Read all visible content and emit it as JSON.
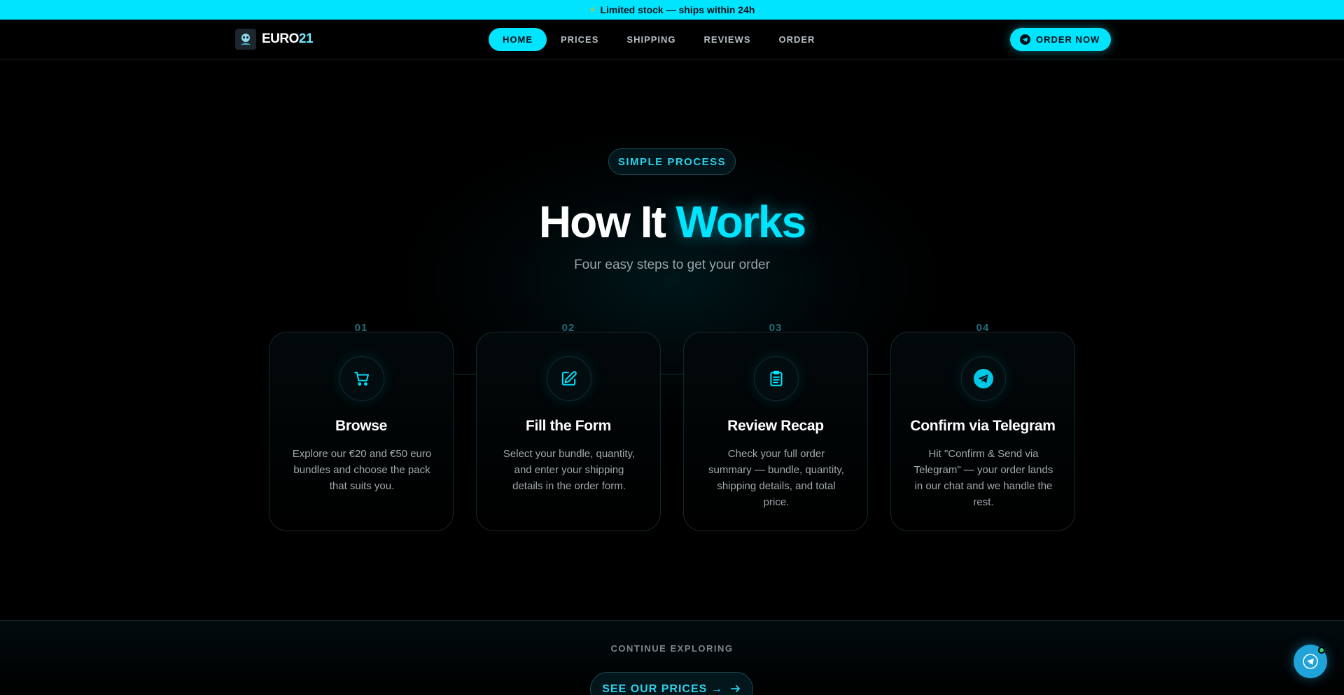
{
  "announcement": {
    "icon": "lightning-bolt-icon",
    "text": "Limited stock — ships within 24h"
  },
  "brand": {
    "logo_icon": "mascot-logo-icon",
    "name_main": "EURO",
    "name_accent": "21"
  },
  "nav": {
    "items": [
      {
        "label": "HOME",
        "active": true
      },
      {
        "label": "PRICES",
        "active": false
      },
      {
        "label": "SHIPPING",
        "active": false
      },
      {
        "label": "REVIEWS",
        "active": false
      },
      {
        "label": "ORDER",
        "active": false
      }
    ],
    "cta_label": "ORDER NOW",
    "cta_icon": "telegram-icon"
  },
  "hero": {
    "badge": "SIMPLE PROCESS",
    "title_main": "How It",
    "title_accent": "Works",
    "subtitle": "Four easy steps to get your order"
  },
  "steps": [
    {
      "number": "01",
      "icon": "cart-icon",
      "title": "Browse",
      "description": "Explore our €20 and €50 euro bundles and choose the pack that suits you."
    },
    {
      "number": "02",
      "icon": "edit-icon",
      "title": "Fill the Form",
      "description": "Select your bundle, quantity, and enter your shipping details in the order form."
    },
    {
      "number": "03",
      "icon": "clipboard-icon",
      "title": "Review Recap",
      "description": "Check your full order summary — bundle, quantity, shipping details, and total price."
    },
    {
      "number": "04",
      "icon": "telegram-icon",
      "title": "Confirm via Telegram",
      "description": "Hit \"Confirm & Send via Telegram\" — your order lands in our chat and we handle the rest."
    }
  ],
  "footer_section": {
    "label": "CONTINUE EXPLORING",
    "button_label": "SEE OUR PRICES →",
    "button_icon": "arrow-right-icon"
  },
  "floating": {
    "icon": "telegram-icon",
    "status": "online"
  },
  "colors": {
    "accent": "#00e5ff",
    "background": "#000000",
    "muted_text": "#9aa4aa"
  }
}
